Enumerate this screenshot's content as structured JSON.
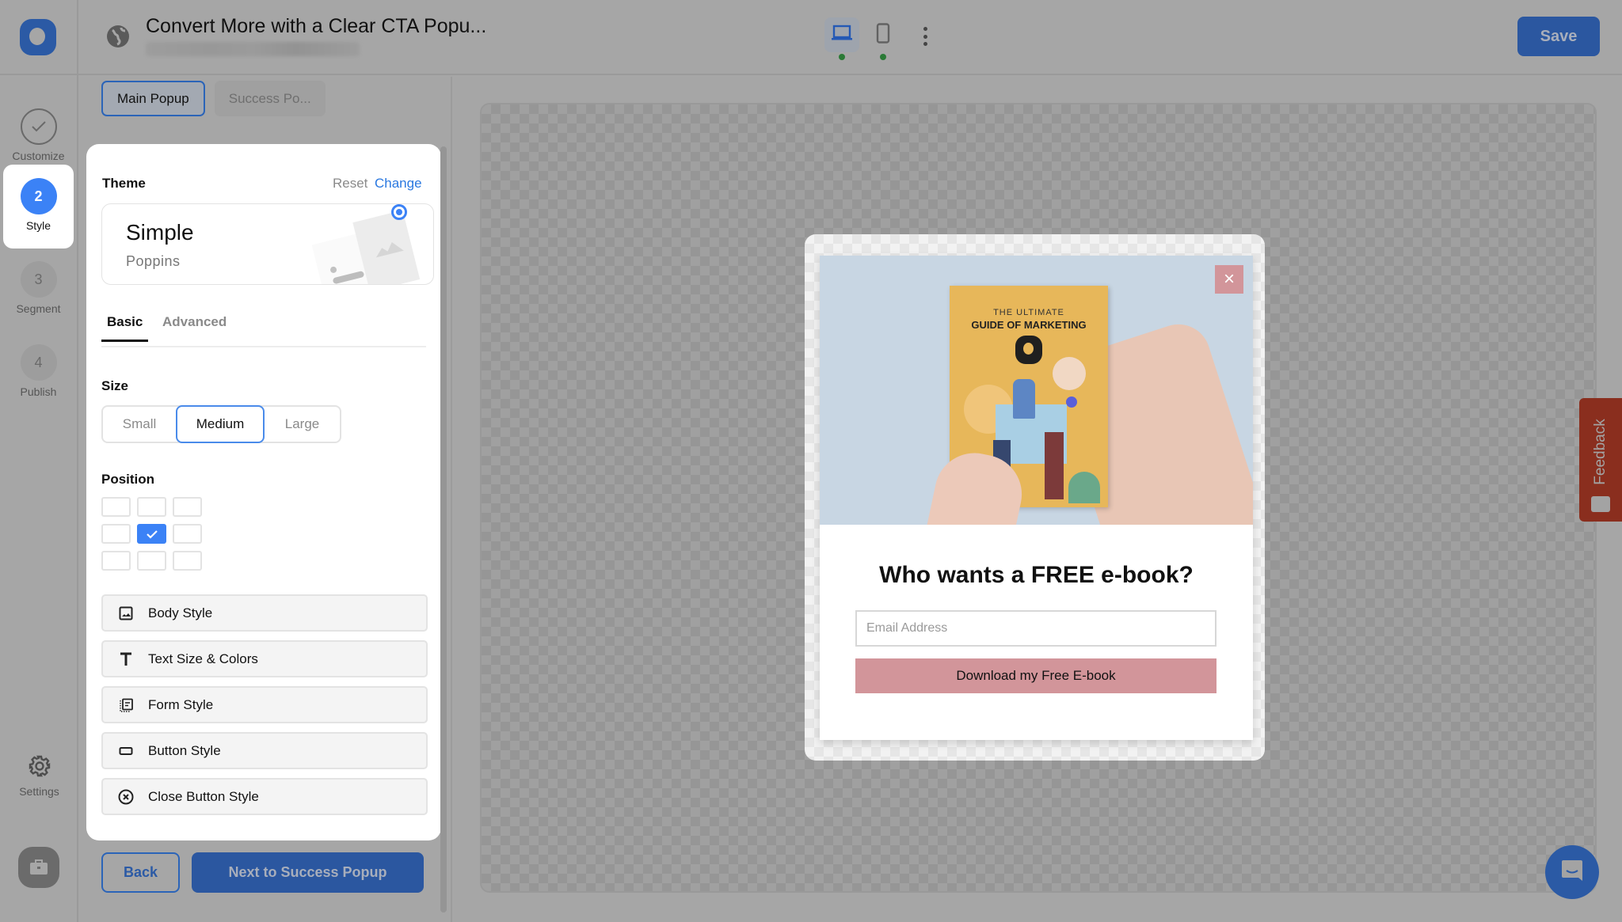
{
  "header": {
    "title": "Convert More with a Clear CTA Popu...",
    "globe_icon": "globe-icon",
    "devices": [
      {
        "name": "desktop",
        "icon": "laptop-icon",
        "active": true,
        "status_color": "#2a7a36"
      },
      {
        "name": "mobile",
        "icon": "phone-icon",
        "active": false,
        "status_color": "#2a7a36"
      }
    ],
    "more_icon": "kebab-menu-icon",
    "save_label": "Save"
  },
  "sidebar": {
    "steps": [
      {
        "number": "✓",
        "label": "Customize",
        "state": "done"
      },
      {
        "number": "2",
        "label": "Style",
        "state": "current"
      },
      {
        "number": "3",
        "label": "Segment",
        "state": "todo"
      },
      {
        "number": "4",
        "label": "Publish",
        "state": "todo"
      }
    ],
    "settings_label": "Settings",
    "settings_icon": "gear-icon",
    "bottom_icon": "briefcase-icon"
  },
  "panel": {
    "popup_tabs": [
      {
        "label": "Main Popup",
        "active": true
      },
      {
        "label": "Success Po...",
        "active": false
      }
    ],
    "theme": {
      "label": "Theme",
      "reset_label": "Reset",
      "change_label": "Change",
      "name": "Simple",
      "font": "Poppins"
    },
    "subtabs": [
      {
        "label": "Basic",
        "active": true
      },
      {
        "label": "Advanced",
        "active": false
      }
    ],
    "size": {
      "label": "Size",
      "options": [
        "Small",
        "Medium",
        "Large"
      ],
      "selected": "Medium"
    },
    "position": {
      "label": "Position",
      "selected_row": 1,
      "selected_col": 1
    },
    "accordions": [
      {
        "label": "Body Style",
        "icon": "image-icon"
      },
      {
        "label": "Text Size & Colors",
        "icon": "text-icon"
      },
      {
        "label": "Form Style",
        "icon": "form-icon"
      },
      {
        "label": "Button Style",
        "icon": "button-icon"
      },
      {
        "label": "Close Button Style",
        "icon": "close-circle-icon"
      }
    ],
    "back_label": "Back",
    "next_label": "Next to Success Popup"
  },
  "preview": {
    "book_subtitle": "THE ULTIMATE",
    "book_title": "GUIDE OF MARKETING",
    "close_label": "×",
    "headline": "Who wants a FREE e-book?",
    "email_placeholder": "Email Address",
    "email_value": "",
    "cta_label": "Download my Free E-book",
    "accent_color": "#d2959a"
  },
  "widgets": {
    "feedback_label": "Feedback",
    "chat_icon": "chat-icon"
  },
  "colors": {
    "primary": "#2b57a0",
    "step_active": "#3b82f6",
    "link": "#2a78e0"
  }
}
